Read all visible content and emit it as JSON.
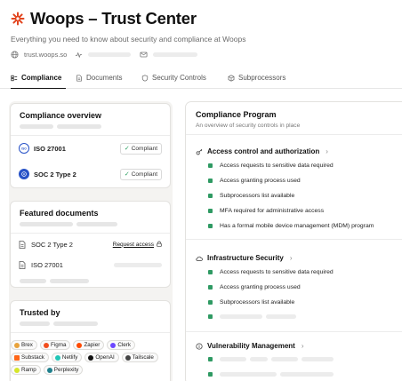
{
  "header": {
    "title": "Woops – Trust Center",
    "subtitle": "Everything you need to know about security and compliance at Woops",
    "website": "trust.woops.so",
    "logo_icon": "woops-starburst-logo",
    "accent_color": "#e2451f"
  },
  "tabs": [
    {
      "label": "Compliance",
      "icon": "compliance-icon",
      "active": true
    },
    {
      "label": "Documents",
      "icon": "document-icon",
      "active": false
    },
    {
      "label": "Security Controls",
      "icon": "shield-icon",
      "active": false
    },
    {
      "label": "Subprocessors",
      "icon": "cube-icon",
      "active": false
    }
  ],
  "compliance_overview": {
    "title": "Compliance overview",
    "items": [
      {
        "name": "ISO 27001",
        "status": "Compliant"
      },
      {
        "name": "SOC 2 Type 2",
        "status": "Compliant"
      }
    ]
  },
  "featured_documents": {
    "title": "Featured documents",
    "items": [
      {
        "name": "SOC 2 Type 2",
        "action": "Request access"
      },
      {
        "name": "ISO 27001"
      }
    ]
  },
  "trusted_by": {
    "title": "Trusted by",
    "companies": [
      {
        "name": "Brex",
        "color": "#e8a33c"
      },
      {
        "name": "Figma",
        "color": "#f24e1e"
      },
      {
        "name": "Zapier",
        "color": "#ff4a00"
      },
      {
        "name": "Clerk",
        "color": "#6c47ff"
      },
      {
        "name": "Substack",
        "color": "#ff6719"
      },
      {
        "name": "Netlify",
        "color": "#20c6b7"
      },
      {
        "name": "OpenAI",
        "color": "#111111"
      },
      {
        "name": "Tailscale",
        "color": "#444444"
      },
      {
        "name": "Ramp",
        "color": "#d6e62a"
      },
      {
        "name": "Perplexity",
        "color": "#20808d"
      }
    ]
  },
  "compliance_program": {
    "title": "Compliance Program",
    "subtitle": "An overview of security controls in place",
    "sections": [
      {
        "title": "Access control and authorization",
        "icon": "key-icon",
        "items": [
          "Access requests to sensitive data required",
          "Access granting process used",
          "Subprocessors list available",
          "MFA required for administrative access",
          "Has a formal mobile device management (MDM) program"
        ]
      },
      {
        "title": "Infrastructure Security",
        "icon": "cloud-icon",
        "items": [
          "Access requests to sensitive data required",
          "Access granting process used",
          "Subprocessors list available"
        ]
      },
      {
        "title": "Vulnerability Management",
        "icon": "info-icon",
        "items": []
      }
    ]
  },
  "status_color": "#2f9a63"
}
